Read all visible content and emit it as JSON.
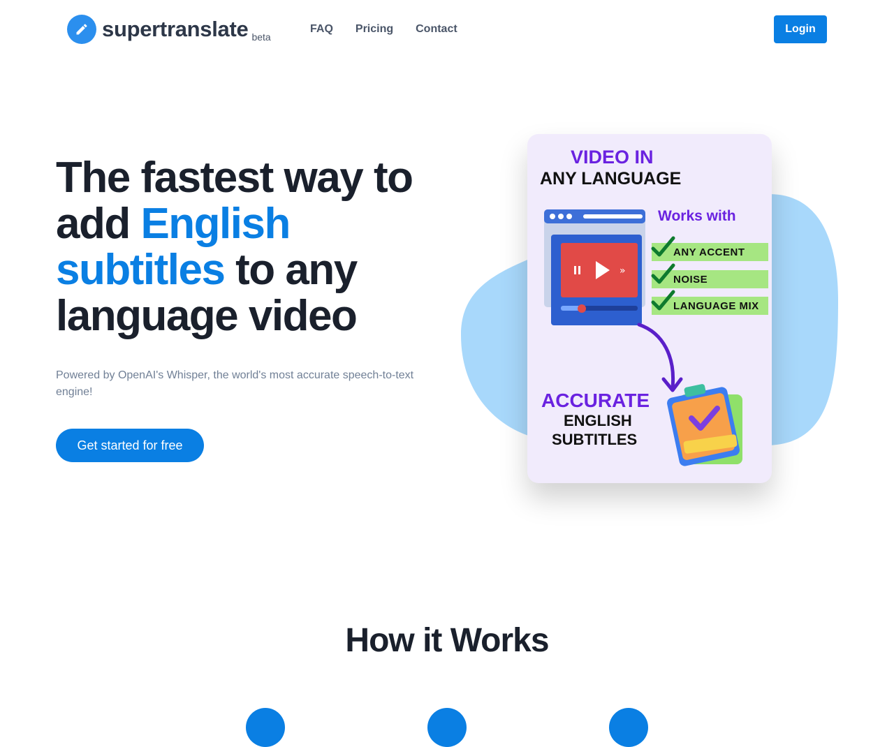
{
  "brand": {
    "name": "supertranslate",
    "badge": "beta"
  },
  "nav": {
    "items": [
      "FAQ",
      "Pricing",
      "Contact"
    ],
    "login": "Login"
  },
  "hero": {
    "title_p1": "The fastest way to add ",
    "title_accent": "English subtitles",
    "title_p2": " to any language video",
    "subtitle": "Powered by OpenAI's Whisper, the world's most accurate speech-to-text engine!",
    "cta": "Get started for free"
  },
  "illustration": {
    "line1": "VIDEO IN",
    "line2": "ANY LANGUAGE",
    "works_with": "Works with",
    "features": [
      "ANY ACCENT",
      "NOISE",
      "LANGUAGE MIX"
    ],
    "result1": "ACCURATE",
    "result2": "ENGLISH",
    "result3": "SUBTITLES"
  },
  "how": {
    "title": "How it Works"
  },
  "colors": {
    "accent": "#0a7fe3",
    "purple": "#6a22e0",
    "blob": "#a8d8fb",
    "card": "#f1ebfc",
    "check_bg": "#a6e682"
  },
  "icons": {
    "logo": "pencil-icon",
    "check": "check-icon"
  }
}
